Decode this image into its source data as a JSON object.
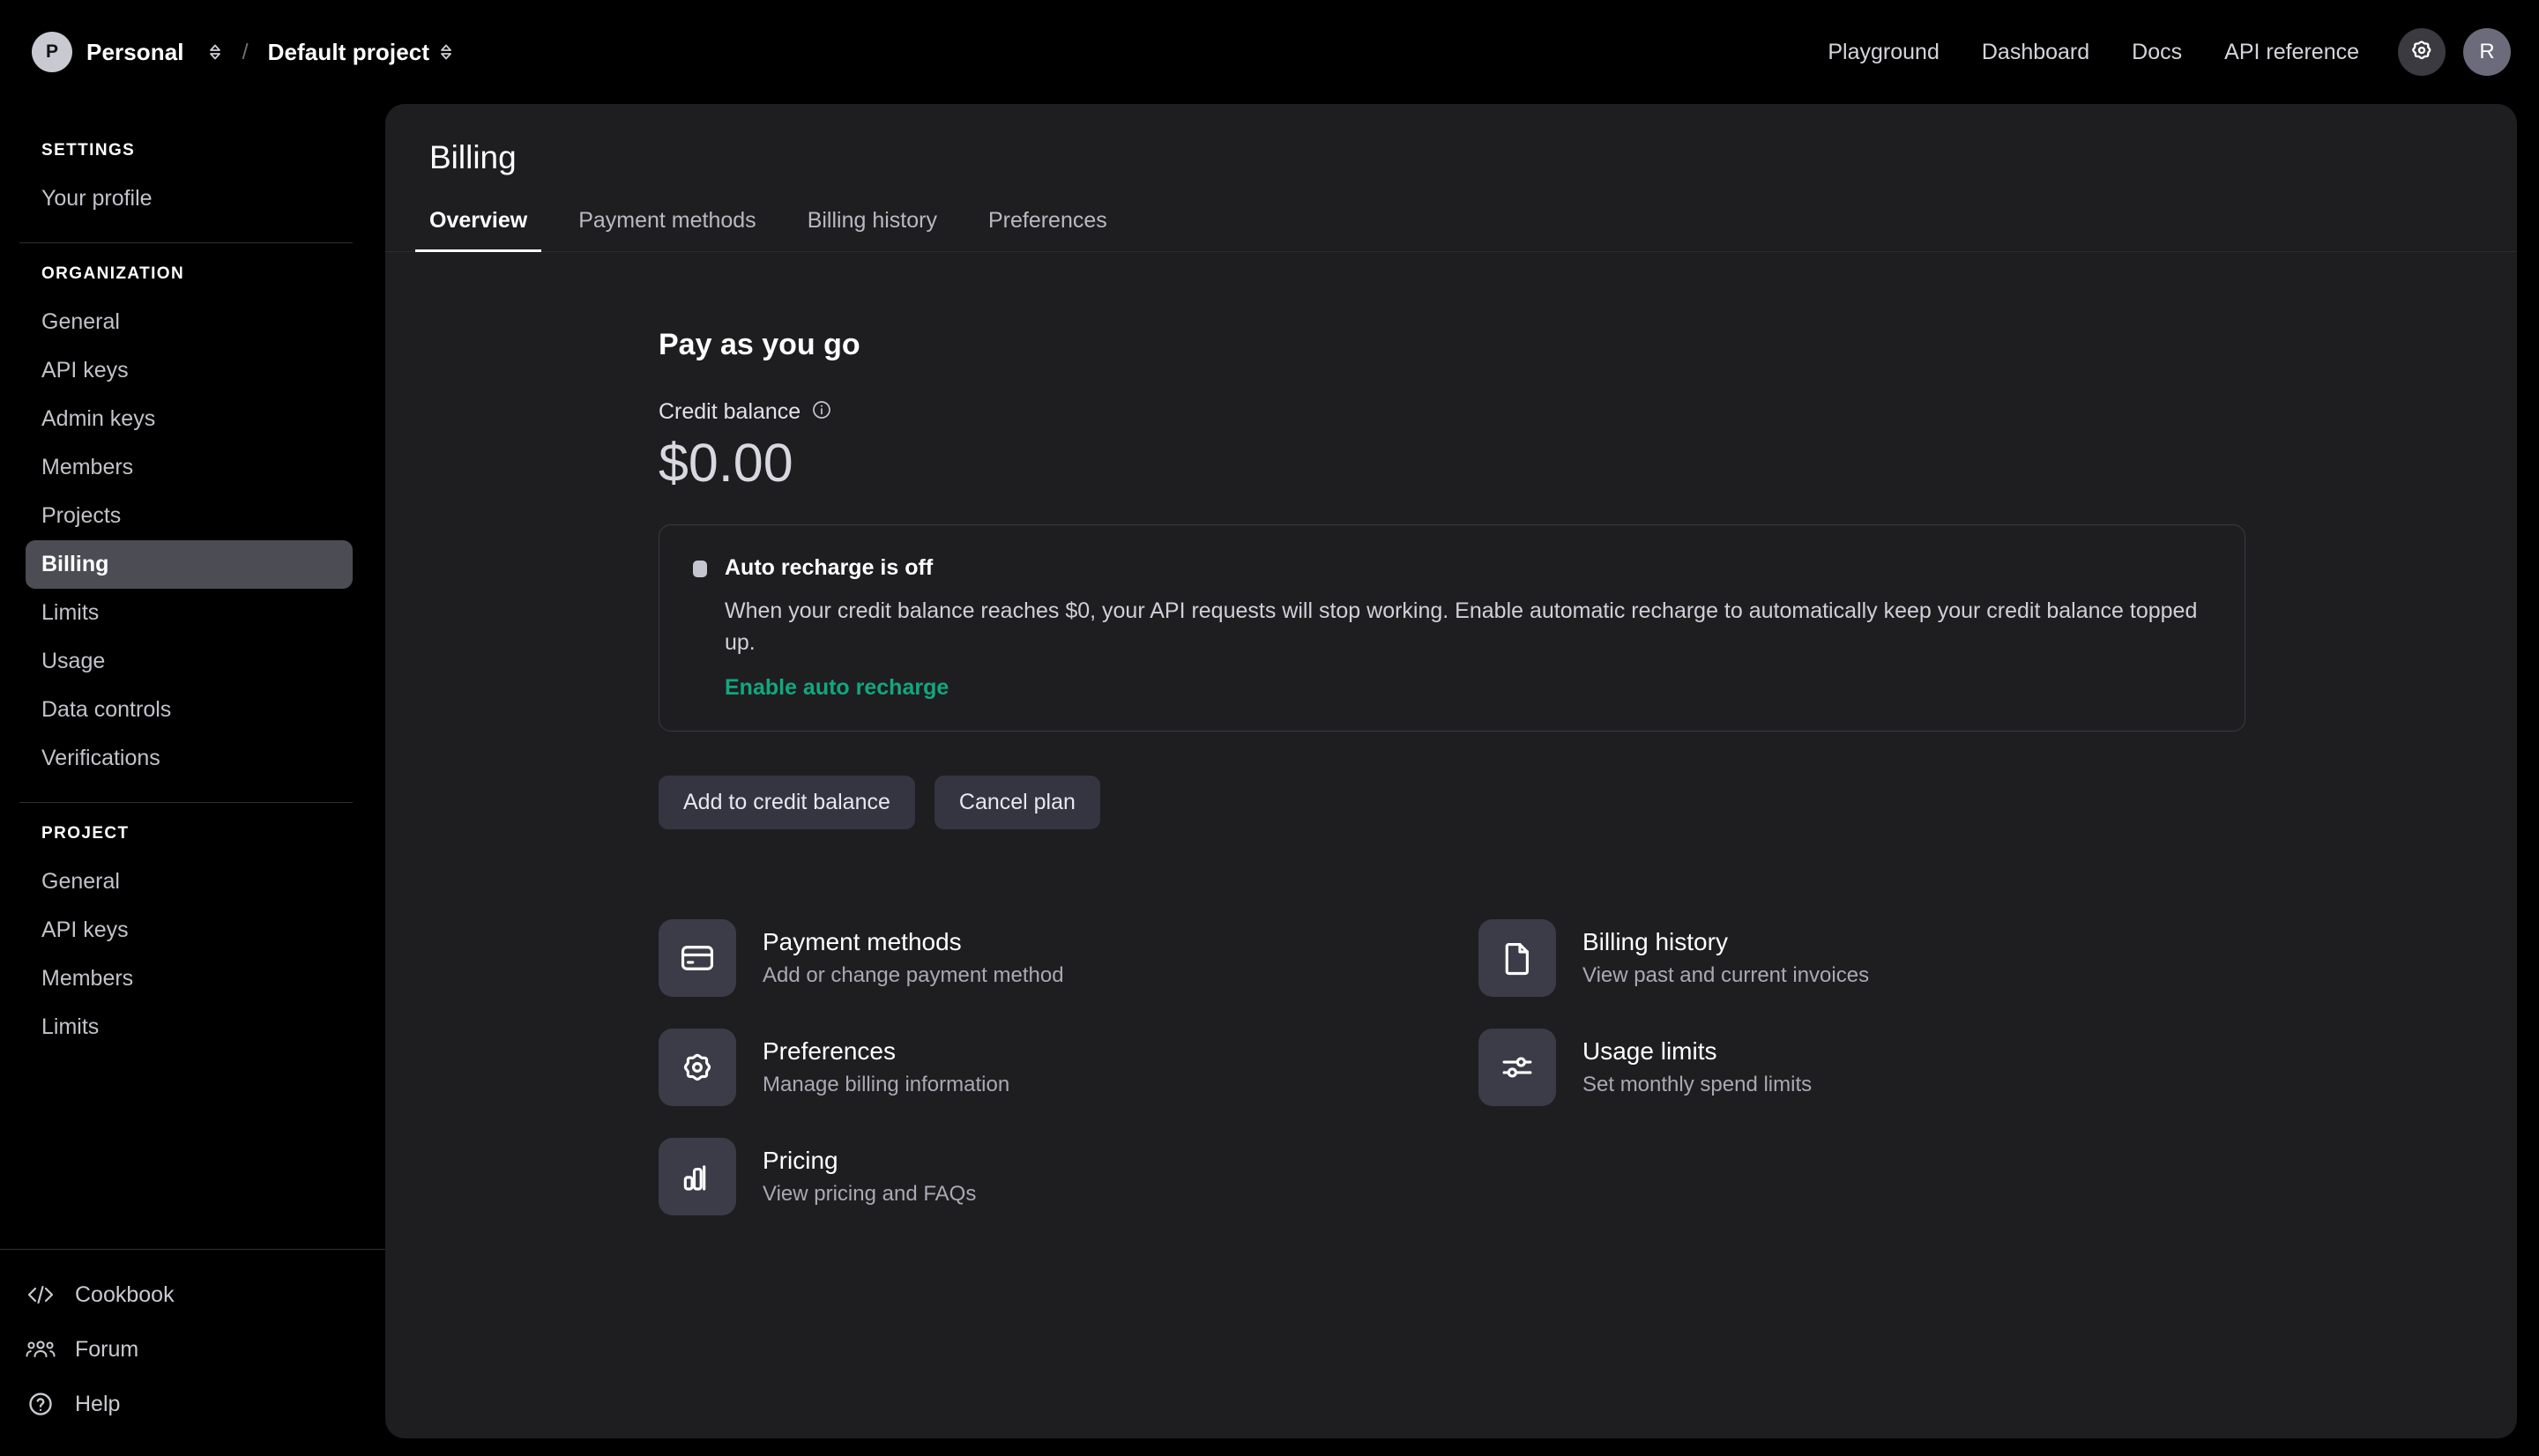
{
  "topbar": {
    "org_initial": "P",
    "org_name": "Personal",
    "separator": "/",
    "project_name": "Default project",
    "nav": [
      {
        "label": "Playground"
      },
      {
        "label": "Dashboard"
      },
      {
        "label": "Docs"
      },
      {
        "label": "API reference"
      }
    ],
    "settings_icon": "gear-icon",
    "user_initial": "R"
  },
  "sidebar": {
    "sections": [
      {
        "title": "SETTINGS",
        "items": [
          {
            "label": "Your profile",
            "active": false
          }
        ]
      },
      {
        "title": "ORGANIZATION",
        "items": [
          {
            "label": "General",
            "active": false
          },
          {
            "label": "API keys",
            "active": false
          },
          {
            "label": "Admin keys",
            "active": false
          },
          {
            "label": "Members",
            "active": false
          },
          {
            "label": "Projects",
            "active": false
          },
          {
            "label": "Billing",
            "active": true
          },
          {
            "label": "Limits",
            "active": false
          },
          {
            "label": "Usage",
            "active": false
          },
          {
            "label": "Data controls",
            "active": false
          },
          {
            "label": "Verifications",
            "active": false
          }
        ]
      },
      {
        "title": "PROJECT",
        "items": [
          {
            "label": "General",
            "active": false
          },
          {
            "label": "API keys",
            "active": false
          },
          {
            "label": "Members",
            "active": false
          },
          {
            "label": "Limits",
            "active": false
          }
        ]
      }
    ],
    "footer": [
      {
        "label": "Cookbook",
        "icon": "code-brackets-icon"
      },
      {
        "label": "Forum",
        "icon": "people-group-icon"
      },
      {
        "label": "Help",
        "icon": "question-circle-icon"
      }
    ]
  },
  "main": {
    "title": "Billing",
    "tabs": [
      {
        "label": "Overview",
        "active": true
      },
      {
        "label": "Payment methods",
        "active": false
      },
      {
        "label": "Billing history",
        "active": false
      },
      {
        "label": "Preferences",
        "active": false
      }
    ],
    "plan_title": "Pay as you go",
    "credit_balance_label": "Credit balance",
    "credit_balance_info_icon": "info-circle-icon",
    "credit_balance_amount": "$0.00",
    "auto_recharge": {
      "toggle_state": "off",
      "title": "Auto recharge is off",
      "description": "When your credit balance reaches $0, your API requests will stop working. Enable automatic recharge to automatically keep your credit balance topped up.",
      "link_label": "Enable auto recharge",
      "link_color": "#13a67f"
    },
    "buttons": [
      {
        "label": "Add to credit balance"
      },
      {
        "label": "Cancel plan"
      }
    ],
    "cards": [
      {
        "title": "Payment methods",
        "subtitle": "Add or change payment method",
        "icon": "credit-card-icon"
      },
      {
        "title": "Billing history",
        "subtitle": "View past and current invoices",
        "icon": "document-icon"
      },
      {
        "title": "Preferences",
        "subtitle": "Manage billing information",
        "icon": "gear-icon"
      },
      {
        "title": "Usage limits",
        "subtitle": "Set monthly spend limits",
        "icon": "sliders-icon"
      },
      {
        "title": "Pricing",
        "subtitle": "View pricing and FAQs",
        "icon": "bar-chart-icon"
      }
    ]
  },
  "colors": {
    "page_background": "#000000",
    "panel_background": "#1e1e20",
    "accent_link": "#13a67f",
    "active_nav_background": "#4c4c54",
    "button_background": "#343541",
    "card_icon_background": "#3b3c48"
  }
}
